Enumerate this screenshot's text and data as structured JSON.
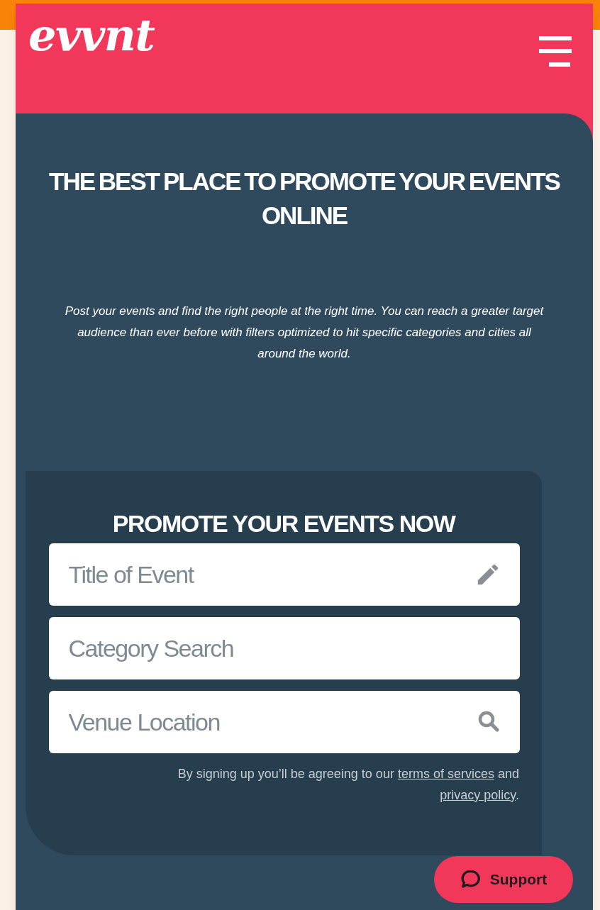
{
  "header": {
    "logo": "evvnt"
  },
  "hero": {
    "title": "THE BEST PLACE TO PROMOTE YOUR EVENTS ONLINE",
    "description": "Post your events and find the right people at the right time. You can reach a greater target audience than ever before with filters optimized to hit specific categories and cities all around the world."
  },
  "form": {
    "title": "PROMOTE YOUR EVENTS NOW",
    "fields": [
      {
        "placeholder": "Title of Event",
        "kind": "pencil"
      },
      {
        "placeholder": "Category Search",
        "kind": "plain"
      },
      {
        "placeholder": "Venue Location",
        "kind": "search"
      }
    ],
    "terms": {
      "before": "By signing up you’ll be agreeing to our",
      "link1": "terms of services",
      "middle": "and",
      "link2": "privacy policy",
      "after": "."
    }
  },
  "support_button": {
    "label": "Support"
  }
}
